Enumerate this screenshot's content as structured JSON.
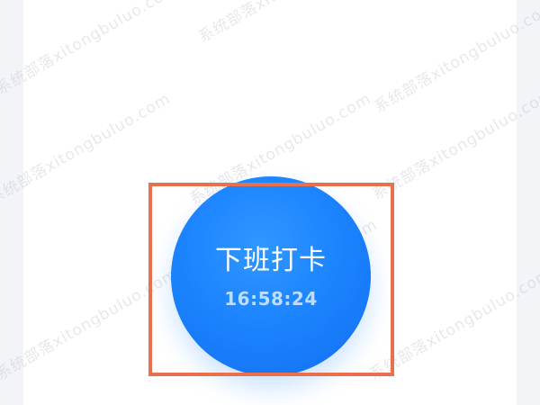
{
  "punch": {
    "label": "下班打卡",
    "time": "16:58:24"
  },
  "watermark": {
    "text": "系统部落xitongbuluo.com"
  },
  "colors": {
    "button": "#1c84ff",
    "highlight": "#e8704f",
    "background": "#f3f4f8",
    "card": "#ffffff"
  }
}
